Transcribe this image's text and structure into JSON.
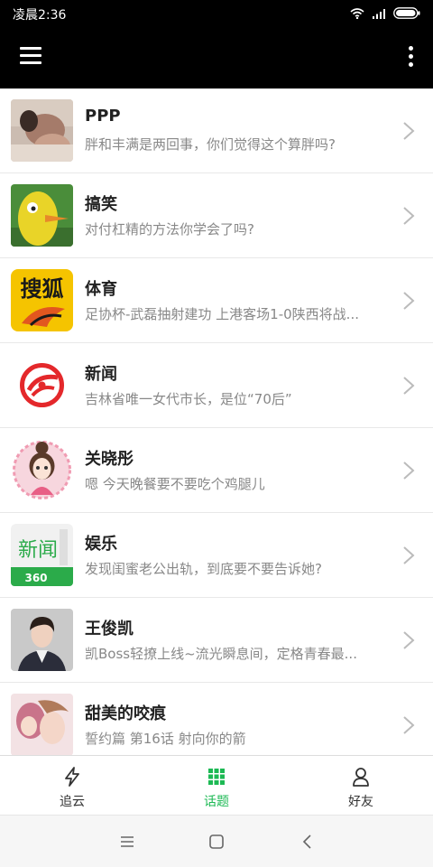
{
  "status_bar": {
    "time": "凌晨2:36"
  },
  "topics": [
    {
      "title": "PPP",
      "desc": "胖和丰满是两回事，你们觉得这个算胖吗?",
      "thumb": "photo-woman"
    },
    {
      "title": "搞笑",
      "desc": "对付杠精的方法你学会了吗?",
      "thumb": "yellow-bird-cartoon"
    },
    {
      "title": "体育",
      "desc": "足协杯-武磊抽射建功 上港客场1-0陕西将战...",
      "thumb": "sohu-logo",
      "logo_text": "搜狐"
    },
    {
      "title": "新闻",
      "desc": "吉林省唯一女代市长，是位“70后”",
      "thumb": "ifeng-logo"
    },
    {
      "title": "关晓彤",
      "desc": "嗯 今天晚餐要不要吃个鸡腿儿",
      "thumb": "cartoon-girl-avatar"
    },
    {
      "title": "娱乐",
      "desc": "发现闺蜜老公出轨，到底要不要告诉她?",
      "thumb": "360-news-logo",
      "logo_text": "新闻",
      "logo_sub": "360"
    },
    {
      "title": "王俊凯",
      "desc": "凯Boss轻撩上线~流光瞬息间，定格青春最...",
      "thumb": "photo-man"
    },
    {
      "title": "甜美的咬痕",
      "desc": "誓约篇 第16话 射向你的箭",
      "thumb": "manga-art"
    }
  ],
  "bottom_nav": [
    {
      "label": "追云",
      "icon": "lightning-icon",
      "active": false
    },
    {
      "label": "话题",
      "icon": "grid-icon",
      "active": true
    },
    {
      "label": "好友",
      "icon": "person-icon",
      "active": false
    }
  ],
  "colors": {
    "accent": "#1db954",
    "header_bg": "#000000",
    "title_text": "#222222",
    "desc_text": "#888888"
  }
}
